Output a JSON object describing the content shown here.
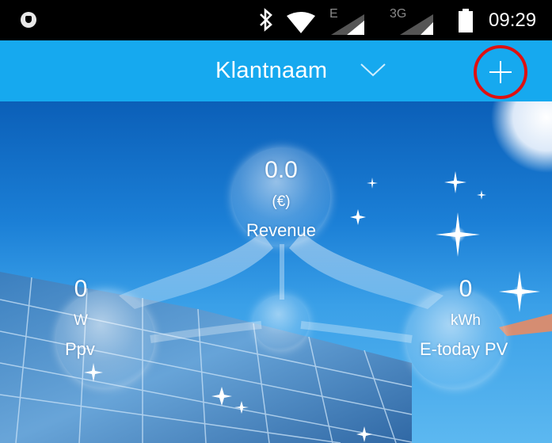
{
  "status_bar": {
    "network_e": "E",
    "network_3g": "3G",
    "time": "09:29"
  },
  "header": {
    "title": "Klantnaam",
    "dropdown_icon": "chevron-down-icon",
    "add_icon": "plus-icon",
    "highlight_color": "#e01010",
    "bar_color": "#16a9ef"
  },
  "metrics": {
    "revenue": {
      "value": "0.0",
      "unit": "(€)",
      "label": "Revenue"
    },
    "ppv": {
      "value": "0",
      "unit": "W",
      "label": "Ppv"
    },
    "etoday": {
      "value": "0",
      "unit": "kWh",
      "label": "E-today PV"
    }
  }
}
